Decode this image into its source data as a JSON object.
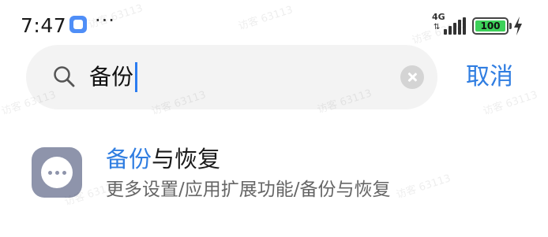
{
  "status_bar": {
    "time": "7:47",
    "network_type": "4G",
    "network_arrows": "⇅",
    "battery_level": "100",
    "more_indicator": "···",
    "icons": [
      "app-notification-icon",
      "signal-icon",
      "battery-icon",
      "charging-icon"
    ]
  },
  "search": {
    "query": "备份",
    "cancel_label": "取消",
    "icons": [
      "search-icon",
      "clear-icon"
    ]
  },
  "results": [
    {
      "title_highlight": "备份",
      "title_rest": "与恢复",
      "path": "更多设置/应用扩展功能/备份与恢复",
      "icon": "more-dots-icon"
    }
  ],
  "watermark_text": "访客 63113",
  "colors": {
    "accent": "#2f7de1",
    "search_bg": "#f3f3f3",
    "result_icon_bg": "#8e94ab",
    "battery_fill": "#3cd159"
  }
}
